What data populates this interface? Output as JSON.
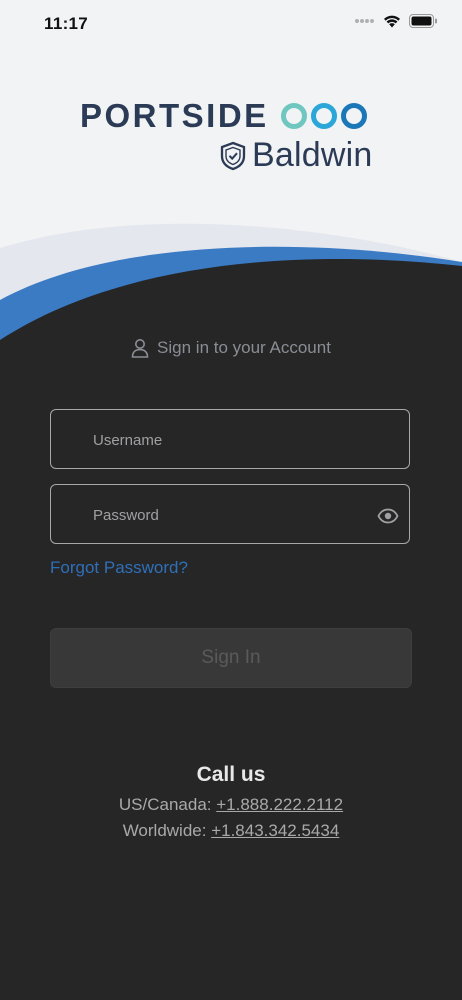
{
  "status_bar": {
    "time": "11:17"
  },
  "logo": {
    "brand": "PORTSIDE",
    "partner": "Baldwin",
    "ring_colors": [
      "#6fc7c0",
      "#2aa6d8",
      "#1a78b8"
    ]
  },
  "login": {
    "heading": "Sign in to your Account",
    "username_placeholder": "Username",
    "password_placeholder": "Password",
    "forgot_label": "Forgot Password?",
    "signin_label": "Sign In"
  },
  "contact": {
    "title": "Call us",
    "us_label": "US/Canada: ",
    "us_phone": "+1.888.222.2112",
    "world_label": "Worldwide: ",
    "world_phone": "+1.843.342.5434"
  },
  "colors": {
    "background_dark": "#262626",
    "wave_blue": "#3b7bc4",
    "link_blue": "#2f6fb8"
  }
}
